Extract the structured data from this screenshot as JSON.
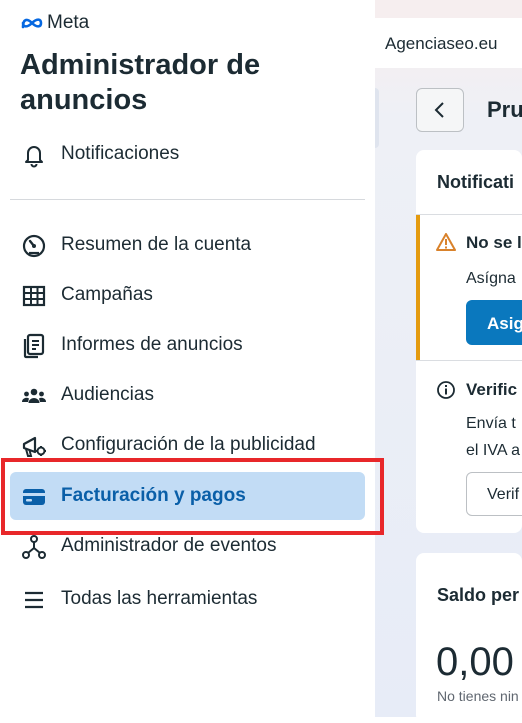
{
  "brand": {
    "logo_text": "Meta"
  },
  "app_title": "Administrador de anuncios",
  "sidebar": {
    "notifications_label": "Notificaciones",
    "items": [
      {
        "label": "Resumen de la cuenta",
        "icon": "gauge-icon"
      },
      {
        "label": "Campañas",
        "icon": "table-icon"
      },
      {
        "label": "Informes de anuncios",
        "icon": "report-icon"
      },
      {
        "label": "Audiencias",
        "icon": "people-icon"
      },
      {
        "label": "Configuración de la publicidad",
        "icon": "megaphone-gear-icon"
      },
      {
        "label": "Facturación y pagos",
        "icon": "credit-card-icon",
        "active": true
      },
      {
        "label": "Administrador de eventos",
        "icon": "events-icon"
      },
      {
        "label": "Todas las herramientas",
        "icon": "menu-icon"
      }
    ]
  },
  "header": {
    "account_name": "Agenciaseo.eu",
    "page_title": "Pru"
  },
  "notifications_card": {
    "title": "Notificati",
    "items": [
      {
        "title": "No se l",
        "body": "Asígna",
        "button": "Asig",
        "icon": "warning-icon"
      },
      {
        "title": "Verific",
        "body_lines": [
          "Envía t",
          "el IVA a"
        ],
        "button": "Verif",
        "icon": "info-icon"
      }
    ]
  },
  "balance_card": {
    "title": "Saldo per",
    "amount": "0,00",
    "note": "No tienes nin"
  },
  "colors": {
    "accent": "#0a78be",
    "active_bg": "#c2dcf5",
    "warning": "#e49b0f",
    "highlight": "#e8272a"
  }
}
